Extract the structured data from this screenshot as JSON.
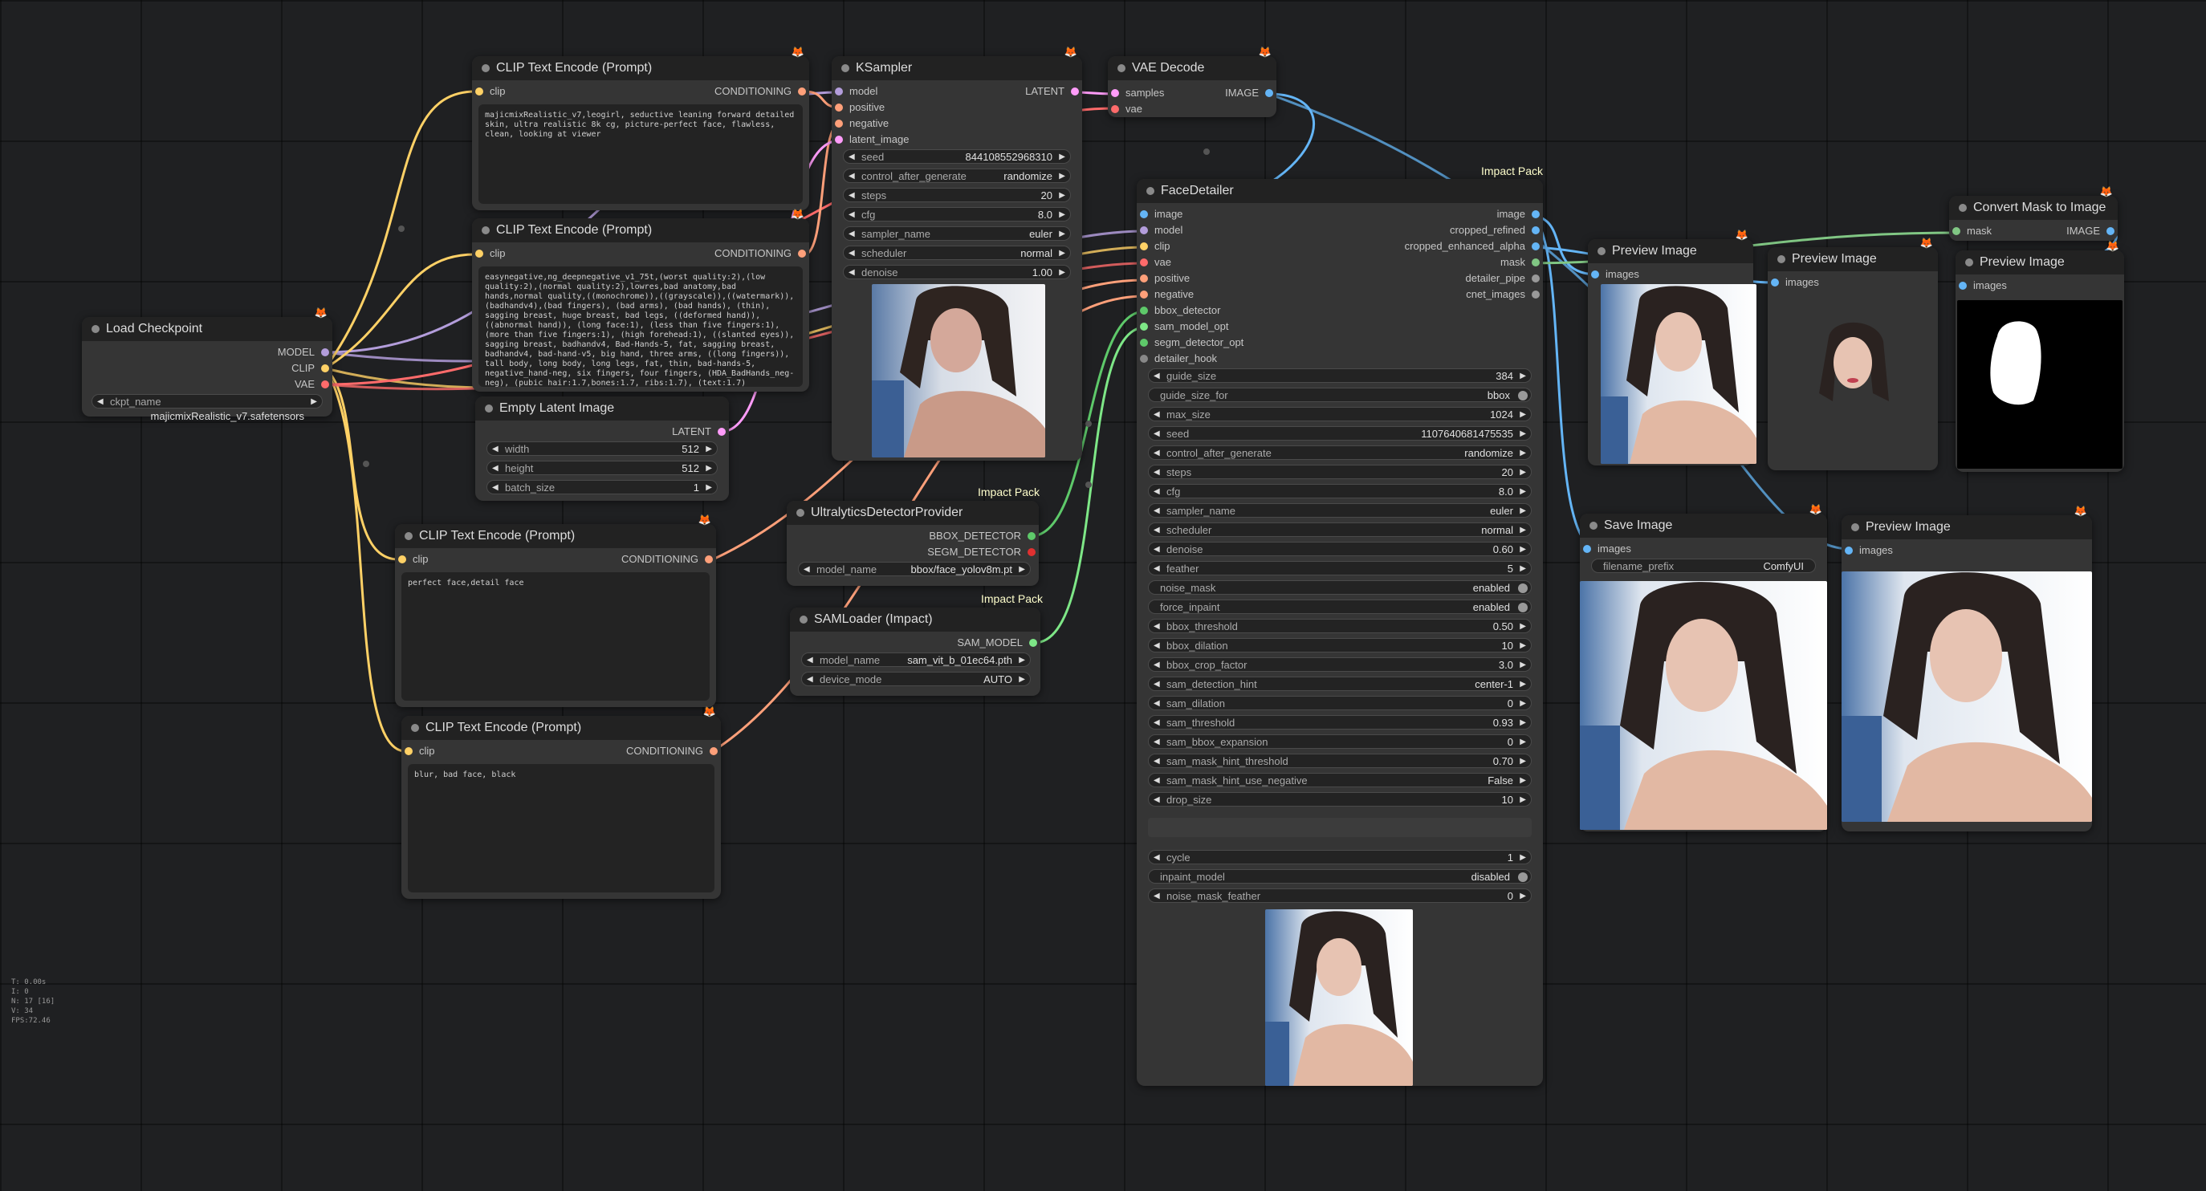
{
  "stats": [
    "T: 0.00s",
    "I: 0",
    "N: 17 [16]",
    "V: 34",
    "FPS:72.46"
  ],
  "colors": {
    "model": "#b39ddb",
    "clip": "#ffd166",
    "vae": "#ff6b6b",
    "conditioning": "#ffa07a",
    "latent": "#ff9cf9",
    "image": "#64b5f6",
    "mask": "#81c784",
    "sam": "#7ee787",
    "detector": "#5ec96a"
  },
  "badges": {
    "impact_pack": "Impact Pack"
  },
  "nodes": {
    "clip1": {
      "title": "CLIP Text Encode (Prompt)",
      "in": "clip",
      "out": "CONDITIONING",
      "text": "majicmixRealistic_v7,leogirl, seductive leaning forward detailed skin, ultra realistic 8k cg, picture-perfect face, flawless, clean, looking at viewer"
    },
    "clip2": {
      "title": "CLIP Text Encode (Prompt)",
      "in": "clip",
      "out": "CONDITIONING",
      "text": "easynegative,ng_deepnegative_v1_75t,(worst quality:2),(low quality:2),(normal quality:2),lowres,bad anatomy,bad hands,normal quality,((monochrome)),((grayscale)),((watermark)),(badhandv4),(bad fingers), (bad arms), (bad hands), (thin), sagging breast, huge breast, bad legs, ((deformed hand)), ((abnormal hand)), (long face:1), (less than five fingers:1), (more than five fingers:1), (high forehead:1), ((slanted eyes)), sagging breast, badhandv4, Bad-Hands-5, fat, sagging breast, badhandv4, bad-hand-v5, big hand, three arms, ((long fingers)), tall body, long body, long legs, fat, thin, bad-hands-5, negative_hand-neg, six fingers, four fingers, (HDA_BadHands_neg-neg), (pubic hair:1.7,bones:1.7, ribs:1.7), (text:1.7)"
    },
    "clip3": {
      "title": "CLIP Text Encode (Prompt)",
      "in": "clip",
      "out": "CONDITIONING",
      "text": "perfect face,detail face"
    },
    "clip4": {
      "title": "CLIP Text Encode (Prompt)",
      "in": "clip",
      "out": "CONDITIONING",
      "text": "blur, bad face, black"
    },
    "checkpoint": {
      "title": "Load Checkpoint",
      "outs": [
        "MODEL",
        "CLIP",
        "VAE"
      ],
      "widget": {
        "label": "ckpt_name",
        "value": "majicmixRealistic_v7.safetensors"
      }
    },
    "latent": {
      "title": "Empty Latent Image",
      "out": "LATENT",
      "widgets": [
        {
          "label": "width",
          "value": "512"
        },
        {
          "label": "height",
          "value": "512"
        },
        {
          "label": "batch_size",
          "value": "1"
        }
      ]
    },
    "ksampler": {
      "title": "KSampler",
      "ins": [
        "model",
        "positive",
        "negative",
        "latent_image"
      ],
      "out": "LATENT",
      "widgets": [
        {
          "label": "seed",
          "value": "844108552968310"
        },
        {
          "label": "control_after_generate",
          "value": "randomize"
        },
        {
          "label": "steps",
          "value": "20"
        },
        {
          "label": "cfg",
          "value": "8.0"
        },
        {
          "label": "sampler_name",
          "value": "euler"
        },
        {
          "label": "scheduler",
          "value": "normal"
        },
        {
          "label": "denoise",
          "value": "1.00"
        }
      ]
    },
    "vaedecode": {
      "title": "VAE Decode",
      "ins": [
        "samples",
        "vae"
      ],
      "out": "IMAGE"
    },
    "ultra": {
      "title": "UltralyticsDetectorProvider",
      "outs": [
        "BBOX_DETECTOR",
        "SEGM_DETECTOR"
      ],
      "widget": {
        "label": "model_name",
        "value": "bbox/face_yolov8m.pt"
      }
    },
    "sam": {
      "title": "SAMLoader (Impact)",
      "out": "SAM_MODEL",
      "widgets": [
        {
          "label": "model_name",
          "value": "sam_vit_b_01ec64.pth"
        },
        {
          "label": "device_mode",
          "value": "AUTO"
        }
      ]
    },
    "face": {
      "title": "FaceDetailer",
      "ins": [
        "image",
        "model",
        "clip",
        "vae",
        "positive",
        "negative",
        "bbox_detector",
        "sam_model_opt",
        "segm_detector_opt",
        "detailer_hook"
      ],
      "outs": [
        "image",
        "cropped_refined",
        "cropped_enhanced_alpha",
        "mask",
        "detailer_pipe",
        "cnet_images"
      ],
      "widgets": [
        {
          "label": "guide_size",
          "value": "384"
        },
        {
          "label": "guide_size_for",
          "value": "bbox",
          "toggle": true
        },
        {
          "label": "max_size",
          "value": "1024"
        },
        {
          "label": "seed",
          "value": "1107640681475535"
        },
        {
          "label": "control_after_generate",
          "value": "randomize"
        },
        {
          "label": "steps",
          "value": "20"
        },
        {
          "label": "cfg",
          "value": "8.0"
        },
        {
          "label": "sampler_name",
          "value": "euler"
        },
        {
          "label": "scheduler",
          "value": "normal"
        },
        {
          "label": "denoise",
          "value": "0.60"
        },
        {
          "label": "feather",
          "value": "5"
        },
        {
          "label": "noise_mask",
          "value": "enabled",
          "toggle": true
        },
        {
          "label": "force_inpaint",
          "value": "enabled",
          "toggle": true
        },
        {
          "label": "bbox_threshold",
          "value": "0.50"
        },
        {
          "label": "bbox_dilation",
          "value": "10"
        },
        {
          "label": "bbox_crop_factor",
          "value": "3.0"
        },
        {
          "label": "sam_detection_hint",
          "value": "center-1"
        },
        {
          "label": "sam_dilation",
          "value": "0"
        },
        {
          "label": "sam_threshold",
          "value": "0.93"
        },
        {
          "label": "sam_bbox_expansion",
          "value": "0"
        },
        {
          "label": "sam_mask_hint_threshold",
          "value": "0.70"
        },
        {
          "label": "sam_mask_hint_use_negative",
          "value": "False"
        },
        {
          "label": "drop_size",
          "value": "10"
        }
      ],
      "widgets2": [
        {
          "label": "cycle",
          "value": "1"
        },
        {
          "label": "inpaint_model",
          "value": "disabled",
          "toggle": true
        },
        {
          "label": "noise_mask_feather",
          "value": "0"
        }
      ]
    },
    "prev1": {
      "title": "Preview Image",
      "in": "images"
    },
    "prev2": {
      "title": "Preview Image",
      "in": "images"
    },
    "convmask": {
      "title": "Convert Mask to Image",
      "in": "mask",
      "out": "IMAGE"
    },
    "prev3": {
      "title": "Preview Image",
      "in": "images"
    },
    "save": {
      "title": "Save Image",
      "in": "images",
      "widget": {
        "label": "filename_prefix",
        "value": "ComfyUI"
      }
    },
    "prev4": {
      "title": "Preview Image",
      "in": "images"
    }
  }
}
